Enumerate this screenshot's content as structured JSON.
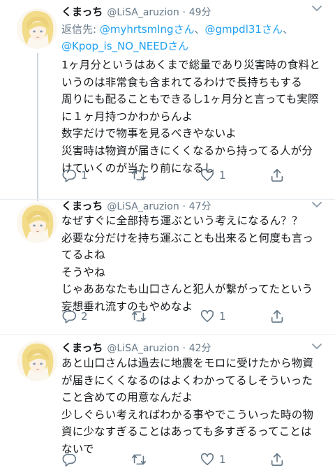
{
  "tweets": [
    {
      "name": "くまっち",
      "handle": "@LiSA_aruzion",
      "dot": "·",
      "time": "49分",
      "reply_prefix": "返信先: ",
      "reply_users": [
        "@myhrtsmlngさん",
        "@gmpdl31さん",
        "@Kpop_is_NO_NEEDさん"
      ],
      "reply_sep": "、",
      "lines": [
        "1ヶ月分というはあくまで総量であり災害時の食料と",
        "いうのは非常食も含まれてるわけで長持ちもする",
        "周りにも配ることもできるし1ヶ月分と言っても実際",
        "に１ヶ月持つかわからんよ",
        "数字だけで物事を見るべきやないよ",
        "災害時は物資が届きにくくなるから持ってる人が分",
        "けていくのが当たり前になるし"
      ],
      "replies": "1",
      "retweets": "",
      "likes": "1"
    },
    {
      "name": "くまっち",
      "handle": "@LiSA_aruzion",
      "dot": "·",
      "time": "47分",
      "lines": [
        "なぜすぐに全部持ち運ぶという考えになるん？？",
        "必要な分だけを持ち運ぶことも出来ると何度も言っ",
        "てるよね",
        "そうやね",
        "じゃああなたも山口さんと犯人が繋がってたという",
        "妄想垂れ流すのもやめなよ"
      ],
      "replies": "2",
      "retweets": "",
      "likes": "1"
    },
    {
      "name": "くまっち",
      "handle": "@LiSA_aruzion",
      "dot": "·",
      "time": "42分",
      "lines": [
        "あと山口さんは過去に地震をモロに受けたから物資",
        "が届きにくくなるのはよくわかってるしそういった",
        "こと含めての用意なんだよ",
        "少しぐらい考えればわかる事やでこういった時の物",
        "資に少なすぎることはあっても多すぎるってことは",
        "ないで"
      ],
      "replies": "",
      "retweets": "",
      "likes": "1"
    }
  ],
  "colors": {
    "text": "#14171a",
    "secondary": "#657786",
    "link": "#1da1f2",
    "thread_line": "#ccd6dd"
  },
  "icons": {
    "reply": "reply-icon",
    "retweet": "retweet-icon",
    "like": "like-icon",
    "share": "share-icon",
    "caret": "chevron-down-icon"
  }
}
